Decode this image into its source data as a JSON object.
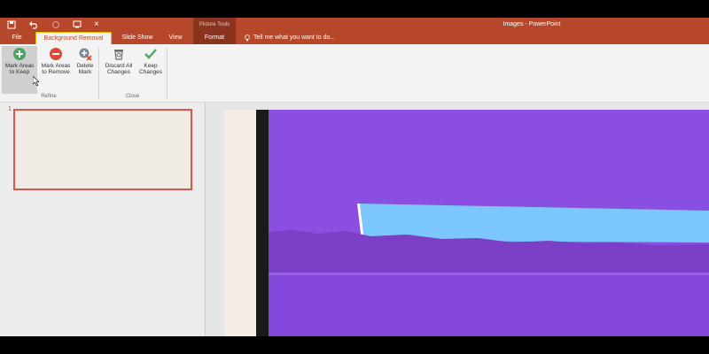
{
  "qat": {
    "save_icon": "save-icon",
    "undo_icon": "undo-icon",
    "customize_icon": "customize-icon",
    "close_x": "×"
  },
  "title": {
    "context_group": "Picture Tools",
    "window_title": "Images - PowerPoint"
  },
  "tabs": {
    "file": "File",
    "background_removal": "Background Removal",
    "slide_show": "Slide Show",
    "view": "View",
    "format": "Format",
    "tell_me": "Tell me what you want to do..."
  },
  "ribbon": {
    "refine": {
      "label": "Refine",
      "mark_keep": "Mark Areas\nto Keep",
      "mark_remove": "Mark Areas\nto Remove",
      "delete_mark": "Delete\nMark"
    },
    "close": {
      "label": "Close",
      "discard": "Discard All\nChanges",
      "keep": "Keep\nChanges"
    }
  },
  "slides_pane": {
    "slide_number": "1"
  },
  "colors": {
    "accent": "#b7472a",
    "context_tab": "#8a3420",
    "active_tab_border": "#e8b900",
    "removal_overlay": "#8a4fe0",
    "kept_sky": "#7cc7ff",
    "thumb_border": "#d9574a"
  }
}
